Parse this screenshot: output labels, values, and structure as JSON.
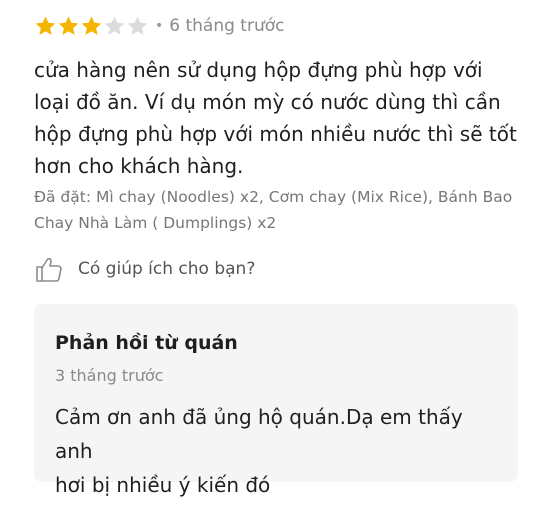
{
  "review": {
    "rating": 3,
    "max_rating": 5,
    "star_color_filled": "#f5b400",
    "star_color_empty": "#dcdcdc",
    "time_ago": "6 tháng trước",
    "text": "cửa hàng nên sử dụng hộp đựng phù hợp với\nloại đồ ăn. Ví dụ món mỳ có nước dùng thì cần\nhộp đựng phù hợp với món nhiều nước thì sẽ tốt\nhơn cho khách hàng.",
    "ordered_items": "Đã đặt: Mì chay (Noodles) x2, Cơm chay (Mix Rice), Bánh Bao Chay Nhà Làm ( Dumplings) x2",
    "helpful_prompt": "Có giúp ích cho bạn?",
    "helpful_icon": "thumbs-up-icon"
  },
  "reply": {
    "title": "Phản hồi từ quán",
    "time_ago": "3 tháng trước",
    "text": "Cảm ơn anh đã ủng hộ quán.Dạ em thấy anh\nhơi bị nhiều ý kiến đó"
  }
}
